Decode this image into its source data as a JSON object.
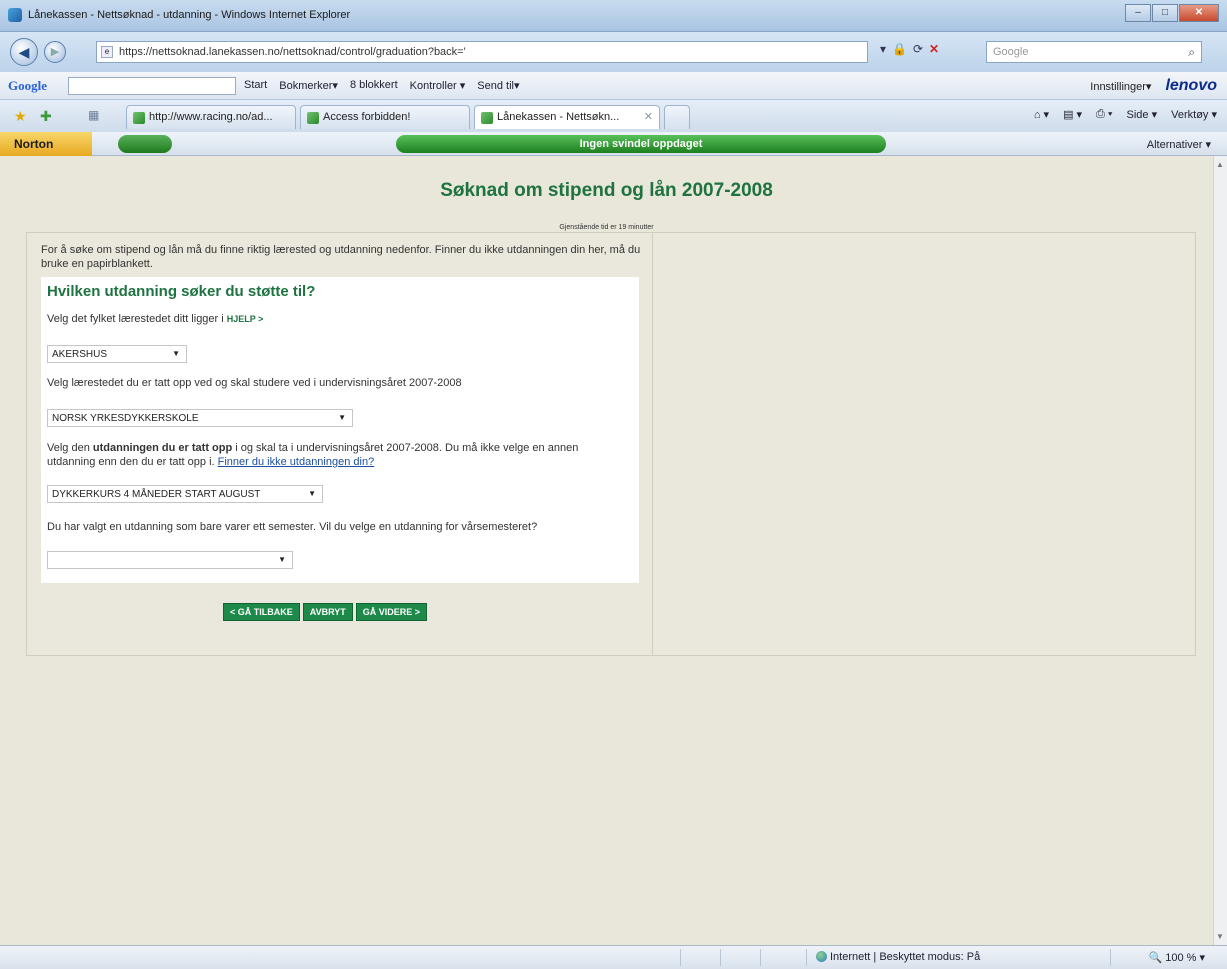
{
  "window": {
    "title": "Lånekassen - Nettsøknad - utdanning - Windows Internet Explorer"
  },
  "address": {
    "url": "https://nettsoknad.lanekassen.no/nettsoknad/control/graduation?back='",
    "search_placeholder": "Google"
  },
  "google_toolbar": {
    "logo": "Google",
    "items": [
      "Start",
      "Bokmerker▾",
      "8 blokkert",
      "Kontroller ▾",
      "Send til▾"
    ],
    "settings": "Innstillinger▾",
    "brand": "lenovo"
  },
  "tabs": [
    {
      "label": "http://www.racing.no/ad..."
    },
    {
      "label": "Access forbidden!"
    },
    {
      "label": "Lånekassen - Nettsøkn..."
    }
  ],
  "commands": [
    "Side ▾",
    "Verktøy ▾"
  ],
  "norton": {
    "logo": "Norton",
    "status": "Ingen svindel oppdaget",
    "alternatives": "Alternativer ▾"
  },
  "page": {
    "heading": "Søknad om stipend og lån 2007-2008",
    "timeout": "Gjenstående tid er 19 minutter",
    "intro": "For å søke om stipend og lån må du finne riktig lærested og utdanning nedenfor. Finner du ikke utdanningen din her, må du bruke en papirblankett.",
    "form_heading": "Hvilken utdanning søker du støtte til?",
    "county_label": "Velg det fylket lærestedet ditt ligger i",
    "help": "HJELP >",
    "county_value": "AKERSHUS",
    "school_label": "Velg lærestedet du er tatt opp ved og skal studere ved i undervisningsåret 2007-2008",
    "school_value": "NORSK YRKESDYKKERSKOLE",
    "education_label_1": "Velg den ",
    "education_label_bold": "utdanningen du er tatt opp",
    "education_label_2": " i og skal ta i undervisningsåret 2007-2008. Du må ikke velge en annen",
    "education_label_3": "utdanning enn den du er tatt opp i. ",
    "education_link": "Finner du ikke utdanningen din?",
    "education_value": "DYKKERKURS 4 MÅNEDER START AUGUST",
    "semester_label": "Du har valgt en utdanning som bare varer ett semester. Vil du velge en utdanning for vårsemesteret?",
    "semester_value": ""
  },
  "buttons": {
    "back": "< GÅ TILBAKE",
    "cancel": "AVBRYT",
    "next": "GÅ VIDERE >"
  },
  "status": {
    "zone": "Internett | Beskyttet modus: På",
    "zoom": "100 %"
  }
}
